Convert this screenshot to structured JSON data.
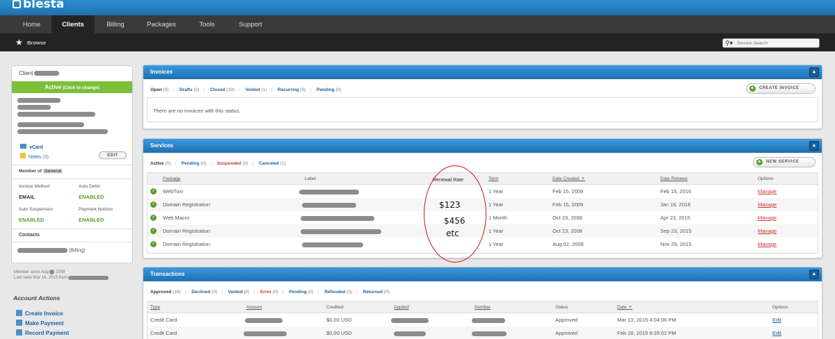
{
  "app": {
    "logo": "blesta"
  },
  "nav": {
    "items": [
      {
        "label": "Home"
      },
      {
        "label": "Clients",
        "active": true
      },
      {
        "label": "Billing"
      },
      {
        "label": "Packages"
      },
      {
        "label": "Tools"
      },
      {
        "label": "Support"
      }
    ]
  },
  "subnav": {
    "browse": "Browse"
  },
  "search": {
    "placeholder": "Service Search"
  },
  "client": {
    "label": "Client",
    "status": "Active",
    "status_hint": "(Click to change)",
    "vcard": "vCard",
    "notes": "Notes",
    "notes_count": "(0)",
    "edit": "EDIT",
    "member_of_label": "Member of",
    "member_of_value": "General",
    "invoice_method_label": "Invoice Method",
    "invoice_method_value": "EMAIL",
    "auto_debit_label": "Auto Debit",
    "auto_debit_value": "ENABLED",
    "auto_suspension_label": "Auto Suspension",
    "auto_suspension_value": "ENABLED",
    "payment_notices_label": "Payment Notices",
    "payment_notices_value": "ENABLED",
    "contacts_label": "Contacts",
    "contact_role": "(Billing)",
    "member_since": "Member since Aug",
    "member_since_year": "2008",
    "last_seen": "Last seen Mar 16, 2015 from"
  },
  "actions": {
    "title": "Account Actions",
    "items": [
      "Create Invoice",
      "Make Payment",
      "Record Payment"
    ]
  },
  "invoices": {
    "title": "Invoices",
    "tabs": [
      {
        "label": "Open",
        "count": "(0)",
        "style": "sel"
      },
      {
        "label": "Drafts",
        "count": "(0)",
        "style": "blue"
      },
      {
        "label": "Closed",
        "count": "(19)",
        "style": "blue"
      },
      {
        "label": "Voided",
        "count": "(1)",
        "style": "blue"
      },
      {
        "label": "Recurring",
        "count": "(0)",
        "style": "blue"
      },
      {
        "label": "Pending",
        "count": "(0)",
        "style": "blue"
      }
    ],
    "create_button": "CREATE INVOICE",
    "empty": "There are no invoices with this status."
  },
  "services": {
    "title": "Services",
    "tabs": [
      {
        "label": "Active",
        "count": "(5)",
        "style": "sel"
      },
      {
        "label": "Pending",
        "count": "(0)",
        "style": "blue"
      },
      {
        "label": "Suspended",
        "count": "(0)",
        "style": "red"
      },
      {
        "label": "Canceled",
        "count": "(1)",
        "style": "blue"
      }
    ],
    "new_button": "NEW SERVICE",
    "columns": [
      "Package",
      "Label",
      "Renewal Rate",
      "Term",
      "Date Created",
      "Date Renews",
      "Options"
    ],
    "rows": [
      {
        "package": "WebTwo",
        "term": "1 Year",
        "created": "Feb 15, 2009",
        "renews": "Feb 15, 2016",
        "option": "Manage"
      },
      {
        "package": "Domain Registration",
        "term": "1 Year",
        "created": "Feb 15, 2009",
        "renews": "Jan 16, 2016",
        "option": "Manage"
      },
      {
        "package": "Web Macro",
        "term": "1 Month",
        "created": "Oct 23, 2008",
        "renews": "Apr 23, 2015",
        "option": "Manage"
      },
      {
        "package": "Domain Registration",
        "term": "1 Year",
        "created": "Oct 23, 2008",
        "renews": "Sep 23, 2015",
        "option": "Manage"
      },
      {
        "package": "Domain Registration",
        "term": "1 Year",
        "created": "Aug 02, 2008",
        "renews": "Nov 29, 2015",
        "option": "Manage"
      }
    ],
    "annotation": [
      "$123",
      "$456",
      "etc"
    ]
  },
  "transactions": {
    "title": "Transactions",
    "tabs": [
      {
        "label": "Approved",
        "count": "(19)",
        "style": "sel"
      },
      {
        "label": "Declined",
        "count": "(0)",
        "style": "blue"
      },
      {
        "label": "Voided",
        "count": "(0)",
        "style": "blue"
      },
      {
        "label": "Error",
        "count": "(0)",
        "style": "red"
      },
      {
        "label": "Pending",
        "count": "(0)",
        "style": "blue"
      },
      {
        "label": "Refunded",
        "count": "(0)",
        "style": "blue"
      },
      {
        "label": "Returned",
        "count": "(0)",
        "style": "blue"
      }
    ],
    "columns": [
      "Type",
      "Amount",
      "Credited",
      "Applied",
      "Number",
      "Status",
      "Date",
      "Options"
    ],
    "rows": [
      {
        "type": "Credit Card",
        "credited": "$0.00 USD",
        "status": "Approved",
        "date": "Mar 13, 2015 4:04:06 PM",
        "option": "Edit"
      },
      {
        "type": "Credit Card",
        "credited": "$0.00 USD",
        "status": "Approved",
        "date": "Feb 28, 2015 8:35:02 PM",
        "option": "Edit"
      }
    ]
  },
  "colors": {
    "brand_blue": "#1f6fae",
    "active_green": "#7cbf3a",
    "danger_red": "#cc3333"
  }
}
